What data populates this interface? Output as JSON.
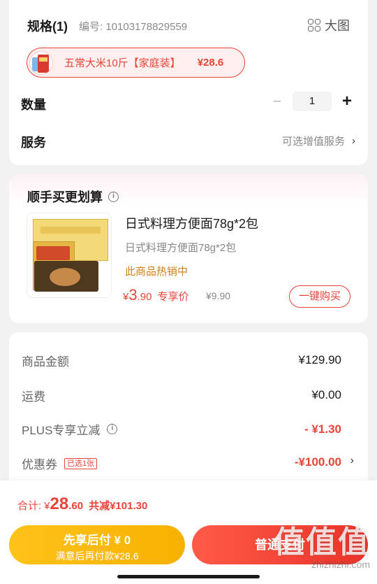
{
  "spec": {
    "title": "规格(1)",
    "code": "编号: 10103178829559",
    "big_view": "大图",
    "chip": {
      "name": "五常大米10斤【家庭装】",
      "price": "¥28.6"
    },
    "quantity_label": "数量",
    "quantity_minus": "−",
    "quantity_value": "1",
    "quantity_plus": "+",
    "service_label": "服务",
    "service_link": "可选增值服务",
    "chevron": "›"
  },
  "bundle": {
    "title": "顺手买更划算",
    "info_glyph": "i",
    "product": {
      "name": "日式料理方便面78g*2包",
      "subtitle": "日式料理方便面78g*2包",
      "hot": "此商品热销中",
      "price_yen": "¥",
      "price_int": "3",
      "price_dec": ".90",
      "price_tag": "专享价",
      "original_price": "¥9.90",
      "buy_button": "一键购买"
    }
  },
  "summary": {
    "rows": [
      {
        "label": "商品金额",
        "value": "¥129.90"
      },
      {
        "label": "运费",
        "value": "¥0.00"
      },
      {
        "label": "PLUS专享立减",
        "value": "- ¥1.30"
      },
      {
        "label": "优惠券",
        "badge": "已选1张",
        "value": "-¥100.00"
      }
    ],
    "chevron": "›"
  },
  "footer": {
    "total_label": "合计:",
    "total_yen": "¥",
    "total_int": "28",
    "total_dec": ".60",
    "total_saving": "共减¥101.30",
    "pay_later": {
      "line1": "先享后付 ¥ 0",
      "line2": "满意后再付款¥28.6"
    },
    "pay_now": "普通支付",
    "watermark": {
      "big": "值值值",
      "small": "zhizhizhi.com"
    }
  },
  "colors": {
    "accent": "#e8443a",
    "pay_later": "#f7b100",
    "hot": "#d0801a"
  }
}
